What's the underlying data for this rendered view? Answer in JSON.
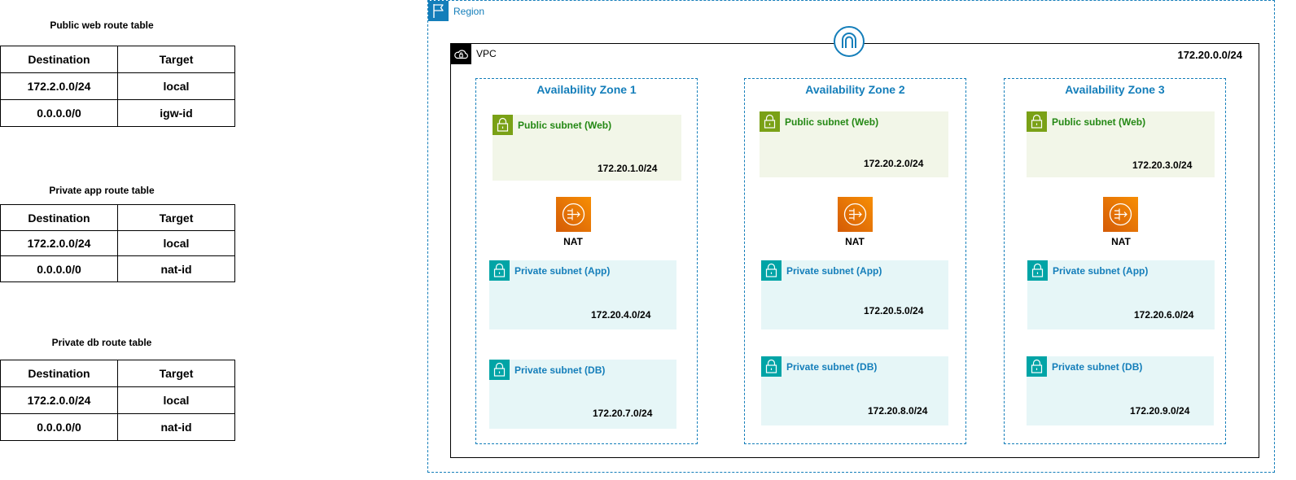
{
  "route_tables": [
    {
      "title": "Public web route table",
      "headers": [
        "Destination",
        "Target"
      ],
      "rows": [
        [
          "172.2.0.0/24",
          "local"
        ],
        [
          "0.0.0.0/0",
          "igw-id"
        ]
      ]
    },
    {
      "title": "Private app route table",
      "headers": [
        "Destination",
        "Target"
      ],
      "rows": [
        [
          "172.2.0.0/24",
          "local"
        ],
        [
          "0.0.0.0/0",
          "nat-id"
        ]
      ]
    },
    {
      "title": "Private db route table",
      "headers": [
        "Destination",
        "Target"
      ],
      "rows": [
        [
          "172.2.0.0/24",
          "local"
        ],
        [
          "0.0.0.0/0",
          "nat-id"
        ]
      ]
    }
  ],
  "region": {
    "label": "Region",
    "icon": "flag-icon"
  },
  "vpc": {
    "label": "VPC",
    "cidr": "172.20.0.0/24",
    "icon": "cloud-lock-icon",
    "gateway_icon": "internet-gateway-icon"
  },
  "azs": [
    {
      "title": "Availability Zone 1",
      "public": {
        "label": "Public subnet (Web)",
        "cidr": "172.20.1.0/24"
      },
      "nat": {
        "label": "NAT"
      },
      "app": {
        "label": "Private subnet (App)",
        "cidr": "172.20.4.0/24"
      },
      "db": {
        "label": "Private subnet (DB)",
        "cidr": "172.20.7.0/24"
      }
    },
    {
      "title": "Availability Zone 2",
      "public": {
        "label": "Public subnet (Web)",
        "cidr": "172.20.2.0/24"
      },
      "nat": {
        "label": "NAT"
      },
      "app": {
        "label": "Private subnet (App)",
        "cidr": "172.20.5.0/24"
      },
      "db": {
        "label": "Private subnet (DB)",
        "cidr": "172.20.8.0/24"
      }
    },
    {
      "title": "Availability Zone 3",
      "public": {
        "label": "Public subnet (Web)",
        "cidr": "172.20.3.0/24"
      },
      "nat": {
        "label": "NAT"
      },
      "app": {
        "label": "Private subnet (App)",
        "cidr": "172.20.6.0/24"
      },
      "db": {
        "label": "Private subnet (DB)",
        "cidr": "172.20.9.0/24"
      }
    }
  ],
  "colors": {
    "region_border": "#147eba",
    "public_subnet_fill": "#f2f6e8",
    "public_subnet_accent": "#7aa116",
    "private_subnet_fill": "#e6f6f7",
    "private_subnet_accent": "#00a4a6",
    "nat_fill": "#ed7100"
  }
}
